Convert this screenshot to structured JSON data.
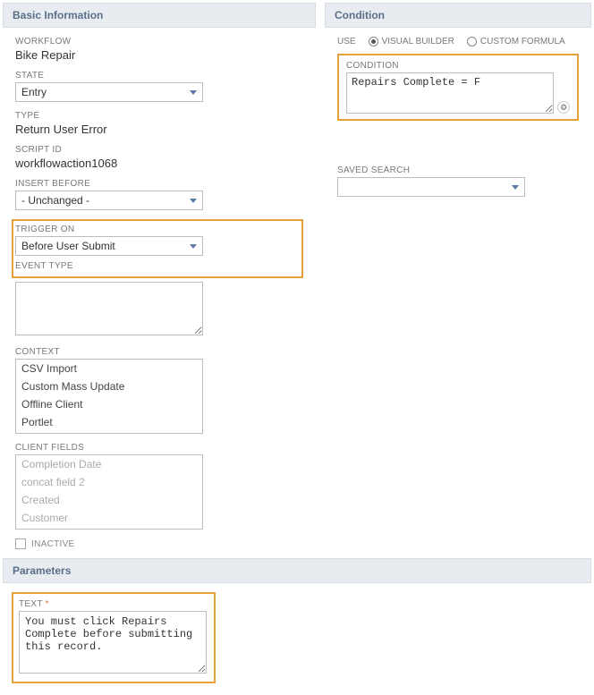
{
  "basic_info": {
    "header": "Basic Information",
    "workflow": {
      "label": "WORKFLOW",
      "value": "Bike Repair"
    },
    "state": {
      "label": "STATE",
      "value": "Entry"
    },
    "type": {
      "label": "TYPE",
      "value": "Return User Error"
    },
    "script_id": {
      "label": "SCRIPT ID",
      "value": "workflowaction1068"
    },
    "insert_before": {
      "label": "INSERT BEFORE",
      "value": "- Unchanged -"
    },
    "trigger_on": {
      "label": "TRIGGER ON",
      "value": "Before User Submit"
    },
    "event_type": {
      "label": "EVENT TYPE",
      "value": ""
    },
    "context": {
      "label": "CONTEXT",
      "items": [
        "CSV Import",
        "Custom Mass Update",
        "Offline Client",
        "Portlet"
      ]
    },
    "client_fields": {
      "label": "CLIENT FIELDS",
      "items": [
        "Completion Date",
        "concat field 2",
        "Created",
        "Customer"
      ]
    },
    "inactive": {
      "label": "INACTIVE",
      "checked": false
    }
  },
  "condition": {
    "header": "Condition",
    "use_label": "USE",
    "visual_builder_label": "VISUAL BUILDER",
    "custom_formula_label": "CUSTOM FORMULA",
    "condition_label": "CONDITION",
    "condition_value": "Repairs Complete = F",
    "saved_search_label": "SAVED SEARCH"
  },
  "parameters": {
    "header": "Parameters",
    "text_label": "TEXT",
    "text_value": "You must click Repairs Complete before submitting this record."
  }
}
